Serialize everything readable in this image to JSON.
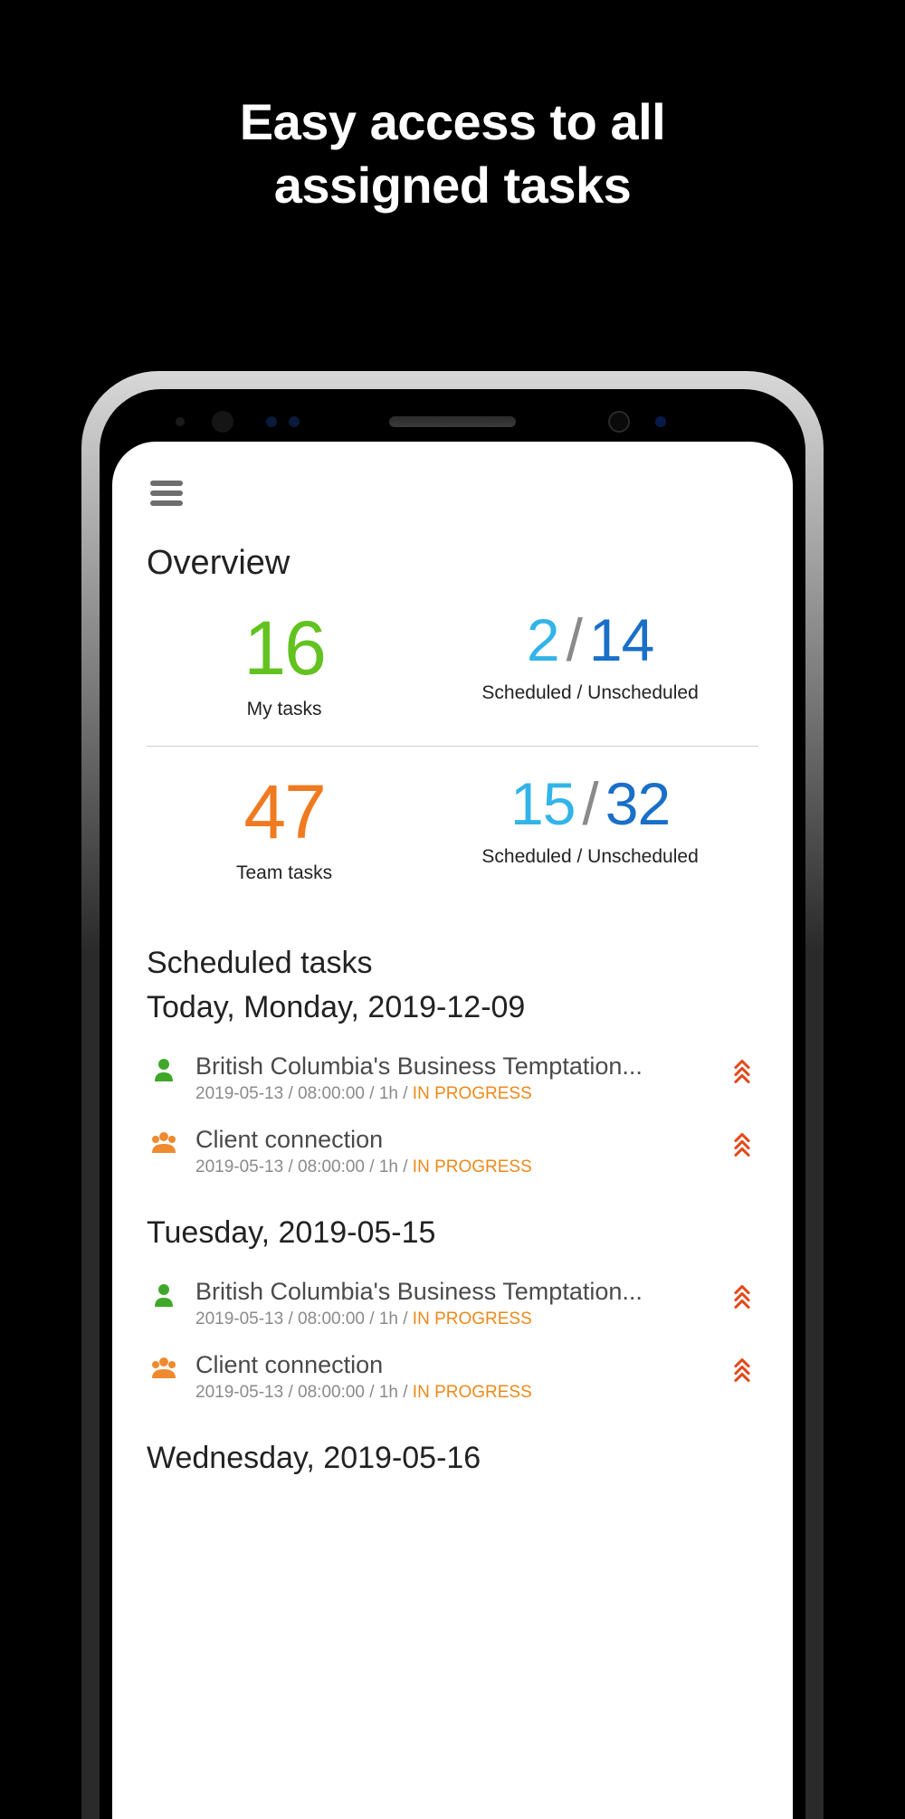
{
  "promo": {
    "headline": "Easy access to all\nassigned tasks"
  },
  "header": {
    "title": "Overview"
  },
  "stats": {
    "my": {
      "count": "16",
      "label": "My tasks",
      "scheduled": "2",
      "unscheduled": "14",
      "split_label": "Scheduled / Unscheduled"
    },
    "team": {
      "count": "47",
      "label": "Team tasks",
      "scheduled": "15",
      "unscheduled": "32",
      "split_label": "Scheduled / Unscheduled"
    }
  },
  "scheduled": {
    "section_title": "Scheduled tasks",
    "groups": [
      {
        "heading": "Today, Monday, 2019-12-09",
        "tasks": [
          {
            "icon": "person",
            "title": "British Columbia's Business Temptation...",
            "meta_prefix": "2019-05-13 / 08:00:00 / 1h / ",
            "status": "IN PROGRESS"
          },
          {
            "icon": "group",
            "title": "Client connection",
            "meta_prefix": "2019-05-13 / 08:00:00 / 1h / ",
            "status": "IN PROGRESS"
          }
        ]
      },
      {
        "heading": "Tuesday, 2019-05-15",
        "tasks": [
          {
            "icon": "person",
            "title": "British Columbia's Business Temptation...",
            "meta_prefix": "2019-05-13 / 08:00:00 / 1h / ",
            "status": "IN PROGRESS"
          },
          {
            "icon": "group",
            "title": "Client connection",
            "meta_prefix": "2019-05-13 / 08:00:00 / 1h / ",
            "status": "IN PROGRESS"
          }
        ]
      },
      {
        "heading": "Wednesday, 2019-05-16",
        "tasks": []
      }
    ]
  },
  "icons": {
    "person": "person-icon",
    "group": "group-icon",
    "priority": "priority-high-icon",
    "menu": "menu-icon"
  },
  "colors": {
    "green": "#62c21f",
    "orange": "#f07a1f",
    "blue_light": "#32b4e8",
    "blue_dark": "#1a6fc7",
    "status": "#ec8a1a",
    "priority": "#e24a1a"
  }
}
